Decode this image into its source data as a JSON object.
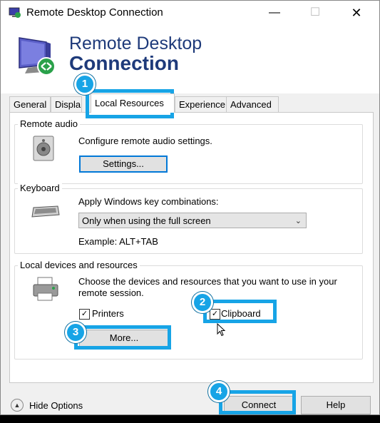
{
  "window": {
    "title": "Remote Desktop Connection"
  },
  "title_buttons": {
    "minimize": "—",
    "maximize": "☐",
    "close": "✕"
  },
  "banner": {
    "line1": "Remote Desktop",
    "line2": "Connection"
  },
  "tabs": [
    {
      "label": "General"
    },
    {
      "label": "Displa"
    },
    {
      "label": "Local Resources"
    },
    {
      "label": "Experience"
    },
    {
      "label": "Advanced"
    }
  ],
  "remote_audio": {
    "title": "Remote audio",
    "description": "Configure remote audio settings.",
    "settings_button": "Settings..."
  },
  "keyboard": {
    "title": "Keyboard",
    "description": "Apply Windows key combinations:",
    "selected": "Only when using the full screen",
    "example": "Example: ALT+TAB"
  },
  "local_devices": {
    "title": "Local devices and resources",
    "description_line1": "Choose the devices and resources that you want to use in your",
    "description_line2": "remote session.",
    "printers_label": "Printers",
    "printers_checked": true,
    "clipboard_label": "Clipboard",
    "clipboard_checked": true,
    "more_button": "More..."
  },
  "footer": {
    "hide_options": "Hide Options",
    "connect": "Connect",
    "help": "Help"
  },
  "callouts": [
    "1",
    "2",
    "3",
    "4"
  ],
  "colors": {
    "accent": "#17a4e6",
    "banner_text": "#1e3a7a"
  }
}
